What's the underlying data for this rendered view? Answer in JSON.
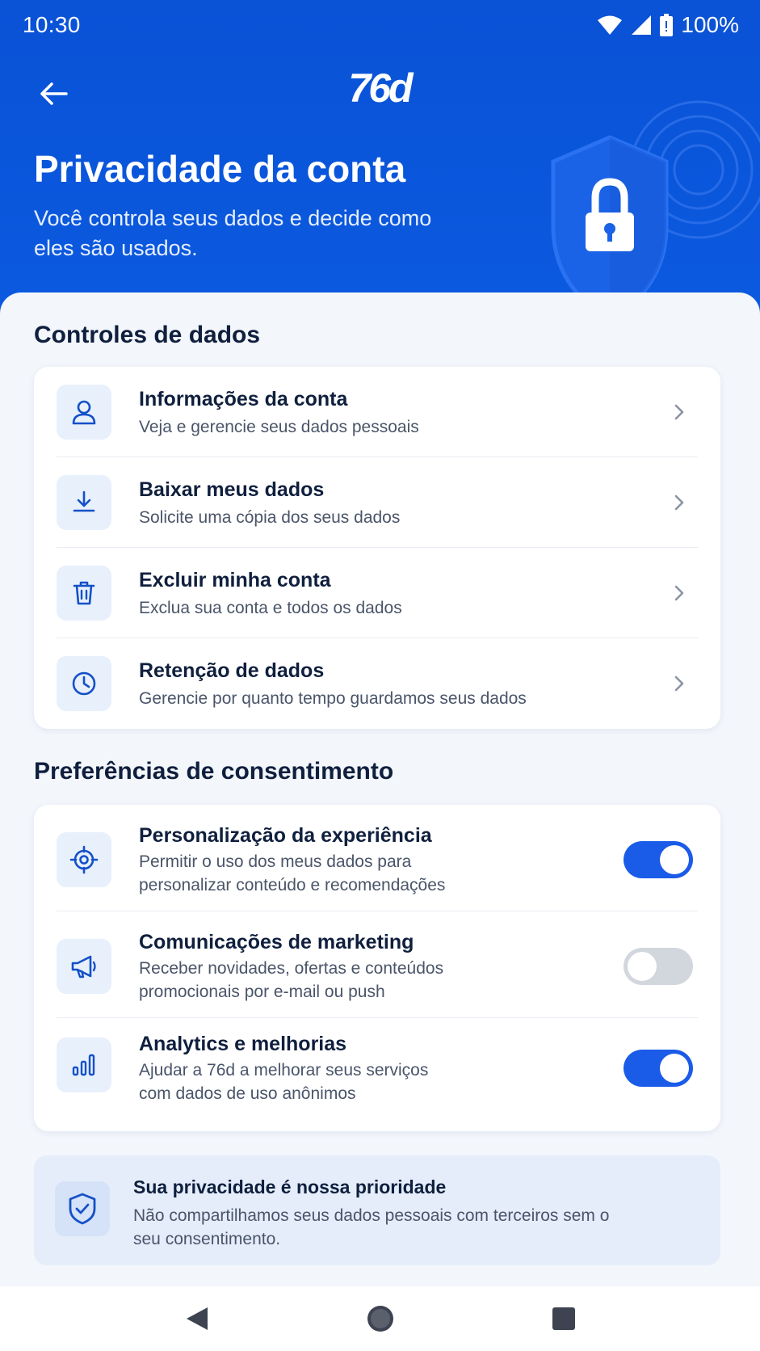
{
  "status": {
    "time": "10:30",
    "battery": "100%"
  },
  "header": {
    "logo": "76d",
    "title": "Privacidade da conta",
    "subtitle": "Você controla seus dados e decide como eles são usados."
  },
  "data_controls": {
    "section_title": "Controles de dados",
    "items": [
      {
        "title": "Informações da conta",
        "desc": "Veja e gerencie seus dados pessoais",
        "icon": "user-icon"
      },
      {
        "title": "Baixar meus dados",
        "desc": "Solicite uma cópia dos seus dados",
        "icon": "download-icon"
      },
      {
        "title": "Excluir minha conta",
        "desc": "Exclua sua conta e todos os dados",
        "icon": "trash-icon"
      },
      {
        "title": "Retenção de dados",
        "desc": "Gerencie por quanto tempo guardamos seus dados",
        "icon": "clock-icon"
      }
    ]
  },
  "consent": {
    "section_title": "Preferências de consentimento",
    "items": [
      {
        "title": "Personalização da experiência",
        "desc_line1": "Permitir o uso dos meus dados para",
        "desc_line2": "personalizar conteúdo e recomendações",
        "enabled": true,
        "icon": "target-icon"
      },
      {
        "title": "Comunicações de marketing",
        "desc_line1": "Receber novidades, ofertas e conteúdos",
        "desc_line2": "promocionais por e-mail ou push",
        "enabled": false,
        "icon": "megaphone-icon"
      },
      {
        "title": "Analytics e melhorias",
        "desc_line1": "Ajudar a 76d a melhorar seus serviços",
        "desc_line2": "com dados de uso anônimos",
        "enabled": true,
        "icon": "bar-chart-icon"
      }
    ]
  },
  "privacy_note": {
    "title": "Sua privacidade é nossa prioridade",
    "text": "Não compartilhamos seus dados pessoais com terceiros sem o seu consentimento."
  },
  "colors": {
    "brand": "#0b56dc",
    "toggle_on": "#1a5be8",
    "toggle_off": "#d2d6dd",
    "icon_tint": "#1450c8"
  }
}
